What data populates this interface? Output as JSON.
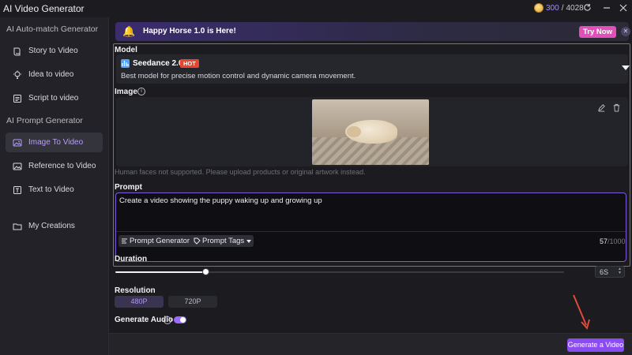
{
  "window": {
    "title": "AI Video Generator",
    "credits_used": "300",
    "credits_sep": "/",
    "credits_total": "4028",
    "icons": [
      "coin-icon",
      "refresh-icon",
      "minimize-icon",
      "close-icon"
    ]
  },
  "sidebar": {
    "section_auto": "AI Auto-match Generator",
    "section_prompt": "AI Prompt Generator",
    "items": [
      {
        "label": "Story to Video",
        "icon": "book-icon"
      },
      {
        "label": "Idea to video",
        "icon": "lightbulb-icon"
      },
      {
        "label": "Script to video",
        "icon": "script-icon"
      },
      {
        "label": "Image To Video",
        "icon": "image-icon",
        "active": true
      },
      {
        "label": "Reference to Video",
        "icon": "image-icon"
      },
      {
        "label": "Text to Video",
        "icon": "text-icon"
      },
      {
        "label": "My Creations",
        "icon": "folder-icon"
      }
    ]
  },
  "banner": {
    "text": "Happy Horse 1.0 is Here!",
    "cta": "Try Now",
    "close": "✕"
  },
  "model": {
    "label": "Model",
    "name": "Seedance 2.0",
    "badge": "HOT",
    "description": "Best model for precise motion control and dynamic camera movement."
  },
  "image": {
    "label": "Image",
    "info": "i",
    "hint": "Human faces not supported. Please upload products or original artwork instead."
  },
  "prompt": {
    "label": "Prompt",
    "value": "Create a video showing the puppy waking up and growing up",
    "generator_label": "Prompt Generator",
    "tags_label": "Prompt Tags",
    "count": "57",
    "max": "/1000"
  },
  "duration": {
    "label": "Duration",
    "value": "6S",
    "slider_fraction": 0.2
  },
  "resolution": {
    "label": "Resolution",
    "options": [
      "480P",
      "720P"
    ],
    "selected": "480P"
  },
  "audio": {
    "label": "Generate Audio",
    "info": "i",
    "enabled": true
  },
  "footer": {
    "generate_label": "Generate a Video"
  },
  "colors": {
    "accent": "#8a4cf0",
    "highlight_frame": "#e24a3a",
    "try_now": "#e24fb8",
    "hot_badge": "#e8452f"
  }
}
